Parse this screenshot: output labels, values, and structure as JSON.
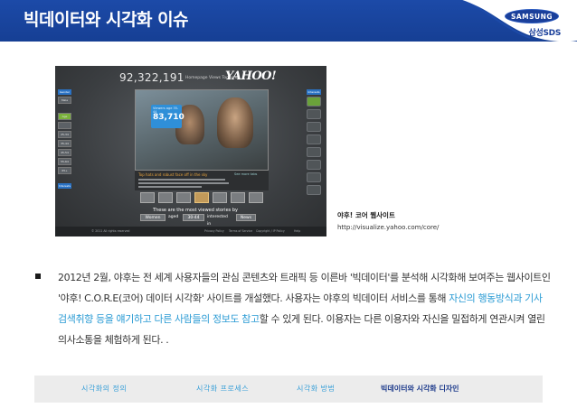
{
  "header": {
    "title": "빅데이터와 시각화 이슈",
    "brand_logo": "SAMSUNG",
    "brand_sub": "삼성SDS"
  },
  "screenshot": {
    "counter": "92,322,191",
    "today_label": "Homepage Views Today on",
    "yahoo_logo": "YAHOO!",
    "left_column": [
      "Gender",
      "Male",
      "Age",
      "",
      "25-34",
      "35-44",
      "45-54",
      "55-64",
      "65+",
      "Interests"
    ],
    "right_column_top": "Interests",
    "age_badge_label": "Viewers age 35-44",
    "age_badge_value": "83,710",
    "story_title": "Top hats and robust face off in the sky",
    "story_link": "See more tabs",
    "most_viewed": "These are the most viewed stories by",
    "filters": {
      "gender": "Women",
      "aged_label": "aged",
      "age": "30-44",
      "interested_label": "interested in",
      "topic": "News"
    },
    "footer_copyright": "© 2011 All rights reserved",
    "footer_links": [
      "Privacy Policy",
      "Terms of Service",
      "Copyright / IP Policy",
      "Help"
    ]
  },
  "caption": {
    "title": "야후! 코어 웹사이트",
    "url": "http://visualize.yahoo.com/core/"
  },
  "body": {
    "part1": "2012년 2월, 야후는 전 세계 사용자들의 관심 콘텐츠와 트래픽 등 이른바 '빅데이터'를 분석해 시각화해 보여주는 웹사이트인 '야후! C.O.R.E(코어) 데이터 시각화' 사이트를 개설했다. 사용자는 야후의 빅데이터 서비스를 통해 ",
    "highlight": "자신의 행동방식과 기사 검색취향 등을 얘기하고 다른 사람들의 정보도 참고",
    "part2": "할 수 있게 된다. 이용자는 다른 이용자와 자신을 밀접하게 연관시켜 열린 의사소통을 체험하게 된다. ."
  },
  "nav": {
    "items": [
      "시각화의 정의",
      "시각화 프로세스",
      "시각화 방법",
      "빅데이터와 시각화 디자인"
    ],
    "active_index": 3
  },
  "colors": {
    "header_bg": "#1c4aa8",
    "highlight": "#2a9bd4",
    "nav_active": "#1f3c8c",
    "nav_inactive": "#3aa0d8"
  }
}
